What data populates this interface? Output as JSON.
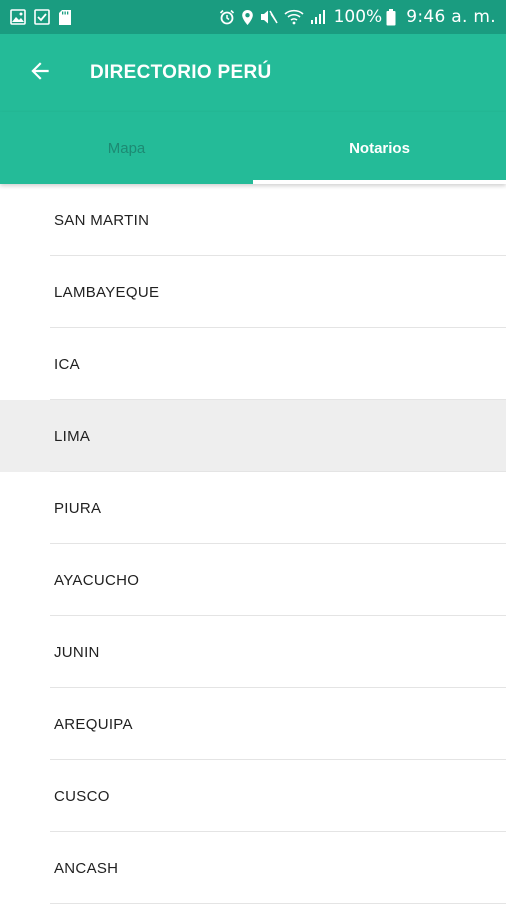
{
  "status_bar": {
    "battery_text": "100%",
    "time": "9:46 a. m.",
    "icons": [
      "image-icon",
      "checkbox-icon",
      "sd-card-icon",
      "alarm-icon",
      "location-icon",
      "mute-icon",
      "wifi-icon",
      "signal-icon",
      "battery-icon"
    ]
  },
  "app_bar": {
    "title": "DIRECTORIO PERÚ",
    "back_icon": "arrow-back-icon"
  },
  "tabs": [
    {
      "label": "Mapa",
      "active": false
    },
    {
      "label": "Notarios",
      "active": true
    }
  ],
  "regions": [
    {
      "label": "SAN MARTIN"
    },
    {
      "label": "LAMBAYEQUE"
    },
    {
      "label": "ICA"
    },
    {
      "label": "LIMA",
      "selected": true
    },
    {
      "label": "PIURA"
    },
    {
      "label": "AYACUCHO"
    },
    {
      "label": "JUNIN"
    },
    {
      "label": "AREQUIPA"
    },
    {
      "label": "CUSCO"
    },
    {
      "label": "ANCASH"
    }
  ],
  "colors": {
    "status_bar": "#1a9c80",
    "primary": "#24bb98",
    "inactive_tab": "#1d8a73",
    "selected_row": "#eeeeee"
  }
}
